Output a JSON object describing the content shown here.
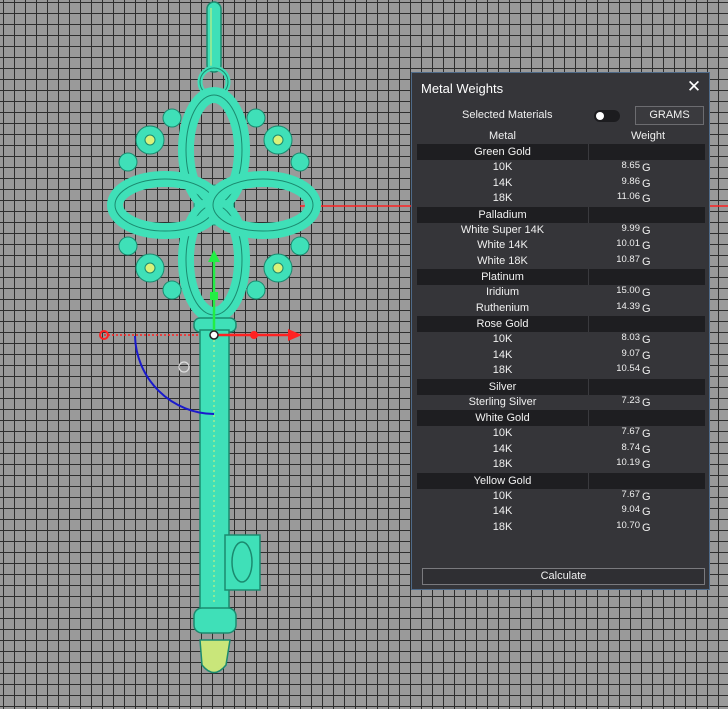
{
  "panel": {
    "title": "Metal Weights",
    "selected_materials_label": "Selected Materials",
    "selected_materials_on": false,
    "unit_button": "GRAMS",
    "column_metal": "Metal",
    "column_weight": "Weight",
    "calculate_label": "Calculate",
    "close_icon": "close-icon",
    "groups": [
      {
        "name": "Green Gold",
        "rows": [
          {
            "karat": "10K",
            "weight": "8.65",
            "unit": "G"
          },
          {
            "karat": "14K",
            "weight": "9.86",
            "unit": "G"
          },
          {
            "karat": "18K",
            "weight": "11.06",
            "unit": "G"
          }
        ]
      },
      {
        "name": "Palladium",
        "rows": [
          {
            "karat": "White Super 14K",
            "weight": "9.99",
            "unit": "G"
          },
          {
            "karat": "White 14K",
            "weight": "10.01",
            "unit": "G"
          },
          {
            "karat": "White 18K",
            "weight": "10.87",
            "unit": "G"
          }
        ]
      },
      {
        "name": "Platinum",
        "rows": [
          {
            "karat": "Iridium",
            "weight": "15.00",
            "unit": "G"
          },
          {
            "karat": "Ruthenium",
            "weight": "14.39",
            "unit": "G"
          }
        ]
      },
      {
        "name": "Rose Gold",
        "rows": [
          {
            "karat": "10K",
            "weight": "8.03",
            "unit": "G"
          },
          {
            "karat": "14K",
            "weight": "9.07",
            "unit": "G"
          },
          {
            "karat": "18K",
            "weight": "10.54",
            "unit": "G"
          }
        ]
      },
      {
        "name": "Silver",
        "rows": [
          {
            "karat": "Sterling Silver",
            "weight": "7.23",
            "unit": "G"
          }
        ]
      },
      {
        "name": "White Gold",
        "rows": [
          {
            "karat": "10K",
            "weight": "7.67",
            "unit": "G"
          },
          {
            "karat": "14K",
            "weight": "8.74",
            "unit": "G"
          },
          {
            "karat": "18K",
            "weight": "10.19",
            "unit": "G"
          }
        ]
      },
      {
        "name": "Yellow Gold",
        "rows": [
          {
            "karat": "10K",
            "weight": "7.67",
            "unit": "G"
          },
          {
            "karat": "14K",
            "weight": "9.04",
            "unit": "G"
          },
          {
            "karat": "18K",
            "weight": "10.70",
            "unit": "G"
          }
        ]
      }
    ]
  },
  "colors": {
    "viewport_bg": "#9a9a9a",
    "grid_line": "#2e2e2e",
    "model_fill": "#3fe0b8",
    "model_outline": "#1b8a6f",
    "model_accent": "#d9f27a",
    "axis_x": "#ff2222",
    "axis_y": "#22ee44",
    "rotate_arc": "#1a1acc",
    "panel_bg": "#353539",
    "panel_border": "#4f6a88"
  }
}
